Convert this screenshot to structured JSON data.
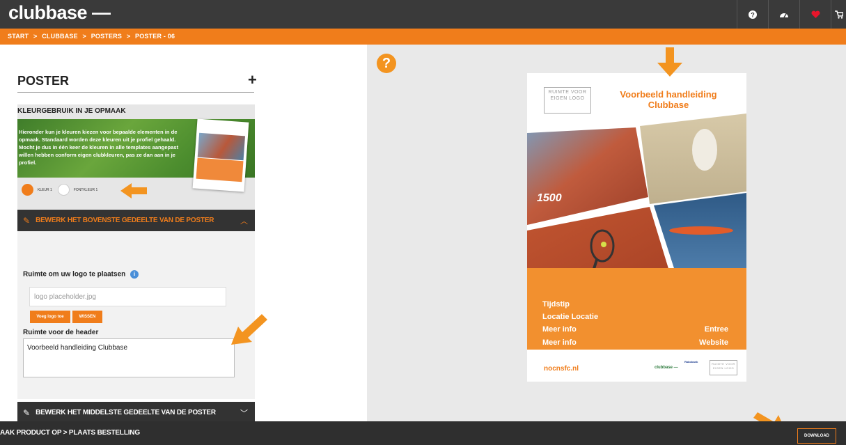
{
  "app": {
    "logo": "clubbase —"
  },
  "topbar": {
    "icons": [
      "help-icon",
      "dashboard-icon",
      "heart-icon",
      "cart-icon"
    ]
  },
  "breadcrumb": {
    "items": [
      "START",
      ">",
      "CLUBBASE",
      ">",
      "POSTERS",
      ">",
      "POSTER - 06"
    ]
  },
  "panel": {
    "title": "POSTER",
    "add_label": "+",
    "color_section": {
      "heading": "KLEURGEBRUIK IN JE OPMAAK",
      "description": "Hieronder kun je kleuren kiezen voor bepaalde elementen in de opmaak. Standaard worden deze kleuren uit je profiel gehaald. Mocht je dus in één keer de kleuren in alle templates aangepast willen hebben conform eigen clubkleuren, pas ze dan aan in je profiel.",
      "swatches": [
        {
          "label": "KLEUR 1",
          "color": "#f07d1b"
        },
        {
          "label": "FONTKLEUR 1",
          "color": "#ffffff"
        }
      ]
    },
    "accordion": [
      {
        "label": "BEWERK HET BOVENSTE GEDEELTE VAN DE POSTER",
        "expanded": true,
        "color": "#f07d1b"
      },
      {
        "label": "BEWERK HET MIDDELSTE GEDEELTE VAN DE POSTER",
        "expanded": false,
        "color": "#ffffff"
      }
    ],
    "logo_field": {
      "label": "Ruimte om uw logo te plaatsen",
      "value": "logo placeholder.jpg",
      "add_button": "Voeg logo toe",
      "clear_button": "WISSEN"
    },
    "header_field": {
      "label": "Ruimte voor de header",
      "value": "Voorbeeld handleiding Clubbase"
    }
  },
  "preview": {
    "logo_placeholder": "RUIMTE VOOR EIGEN LOGO",
    "title": "Voorbeeld handleiding Clubbase",
    "info_left": [
      "Tijdstip",
      "Locatie Locatie",
      "Meer info",
      "Meer info"
    ],
    "info_right": [
      "Entree",
      "Website"
    ],
    "url": "nocnsfc.nl",
    "footer_logos": [
      "clubbase —",
      "Rabobank",
      "RUIMTE VOOR EIGEN LOGO"
    ],
    "track_text": "1500"
  },
  "bottombar": {
    "steps": "AAK PRODUCT OP > PLAATS BESTELLING",
    "download": "DOWNLOAD"
  },
  "colors": {
    "brand_orange": "#f07d1b",
    "dark": "#333333"
  }
}
